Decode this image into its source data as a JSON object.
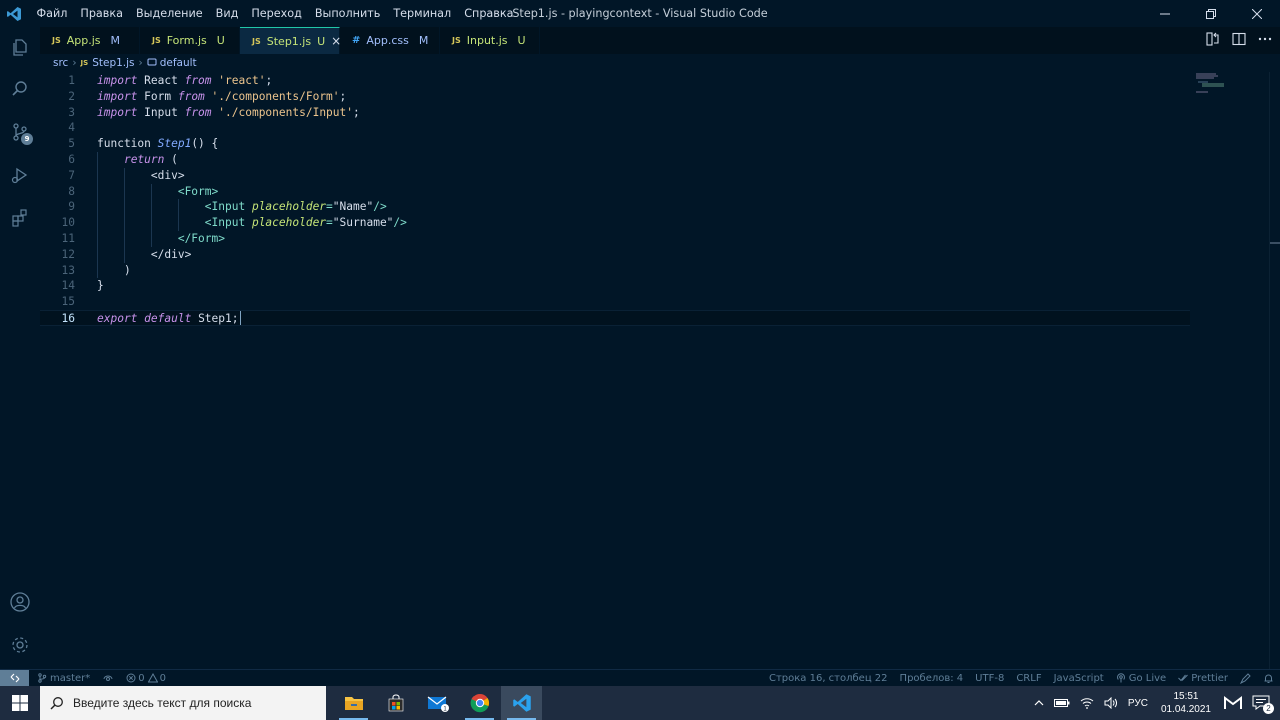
{
  "window": {
    "title": "Step1.js - playingcontext - Visual Studio Code",
    "menu": [
      "Файл",
      "Правка",
      "Выделение",
      "Вид",
      "Переход",
      "Выполнить",
      "Терминал",
      "Справка"
    ]
  },
  "activity_bar": {
    "icons": [
      "files-icon",
      "search-icon",
      "source-control-icon",
      "run-debug-icon",
      "extensions-icon",
      "account-icon",
      "settings-gear-icon"
    ],
    "scm_badge": "9"
  },
  "tabs": [
    {
      "icon": "JS",
      "name": "App.js",
      "status": "M",
      "active": false
    },
    {
      "icon": "JS",
      "name": "Form.js",
      "status": "U",
      "active": false
    },
    {
      "icon": "JS",
      "name": "Step1.js",
      "status": "U",
      "active": true,
      "close": "×"
    },
    {
      "icon": "#",
      "name": "App.css",
      "status": "M",
      "active": false
    },
    {
      "icon": "JS",
      "name": "Input.js",
      "status": "U",
      "active": false
    }
  ],
  "breadcrumb": {
    "folder": "src",
    "file_icon": "JS",
    "file": "Step1.js",
    "symbol": "default"
  },
  "editor": {
    "current_line": 16,
    "lines": [
      {
        "n": "1",
        "tokens": [
          [
            "kw",
            "import"
          ],
          [
            "plain",
            " React "
          ],
          [
            "kw",
            "from"
          ],
          [
            "plain",
            " "
          ],
          [
            "str",
            "'react'"
          ],
          [
            "plain",
            ";"
          ]
        ]
      },
      {
        "n": "2",
        "tokens": [
          [
            "kw",
            "import"
          ],
          [
            "plain",
            " Form "
          ],
          [
            "kw",
            "from"
          ],
          [
            "plain",
            " "
          ],
          [
            "str",
            "'./components/Form'"
          ],
          [
            "plain",
            ";"
          ]
        ]
      },
      {
        "n": "3",
        "tokens": [
          [
            "kw",
            "import"
          ],
          [
            "plain",
            " Input "
          ],
          [
            "kw",
            "from"
          ],
          [
            "plain",
            " "
          ],
          [
            "str",
            "'./components/Input'"
          ],
          [
            "plain",
            ";"
          ]
        ]
      },
      {
        "n": "4",
        "tokens": []
      },
      {
        "n": "5",
        "tokens": [
          [
            "plain",
            "function "
          ],
          [
            "fn",
            "Step1"
          ],
          [
            "plain",
            "() {"
          ]
        ]
      },
      {
        "n": "6",
        "tokens": [
          [
            "plain",
            "    "
          ],
          [
            "kw",
            "return"
          ],
          [
            "plain",
            " ("
          ]
        ]
      },
      {
        "n": "7",
        "tokens": [
          [
            "plain",
            "        "
          ],
          [
            "plain",
            "<div>"
          ]
        ]
      },
      {
        "n": "8",
        "tokens": [
          [
            "plain",
            "            "
          ],
          [
            "tag",
            "<Form>"
          ]
        ]
      },
      {
        "n": "9",
        "tokens": [
          [
            "plain",
            "                "
          ],
          [
            "tag",
            "<Input"
          ],
          [
            "plain",
            " "
          ],
          [
            "attr",
            "placeholder"
          ],
          [
            "tag",
            "="
          ],
          [
            "plain",
            "\"Name\""
          ],
          [
            "tag",
            "/>"
          ]
        ]
      },
      {
        "n": "10",
        "tokens": [
          [
            "plain",
            "                "
          ],
          [
            "tag",
            "<Input"
          ],
          [
            "plain",
            " "
          ],
          [
            "attr",
            "placeholder"
          ],
          [
            "tag",
            "="
          ],
          [
            "plain",
            "\"Surname\""
          ],
          [
            "tag",
            "/>"
          ]
        ]
      },
      {
        "n": "11",
        "tokens": [
          [
            "plain",
            "            "
          ],
          [
            "tag",
            "</Form>"
          ]
        ]
      },
      {
        "n": "12",
        "tokens": [
          [
            "plain",
            "        "
          ],
          [
            "plain",
            "</div>"
          ]
        ]
      },
      {
        "n": "13",
        "tokens": [
          [
            "plain",
            "    )"
          ]
        ]
      },
      {
        "n": "14",
        "tokens": [
          [
            "plain",
            "}"
          ]
        ]
      },
      {
        "n": "15",
        "tokens": []
      },
      {
        "n": "16",
        "tokens": [
          [
            "kw",
            "export"
          ],
          [
            "plain",
            " "
          ],
          [
            "kw",
            "default"
          ],
          [
            "plain",
            " Step1;"
          ]
        ]
      }
    ]
  },
  "status_bar": {
    "branch": "master*",
    "errors": "0",
    "warnings": "0",
    "position": "Строка 16, столбец 22",
    "spaces": "Пробелов: 4",
    "encoding": "UTF-8",
    "eol": "CRLF",
    "language": "JavaScript",
    "go_live": "Go Live",
    "prettier": "Prettier"
  },
  "taskbar": {
    "search_placeholder": "Введите здесь текст для поиска",
    "apps": [
      "file-explorer-icon",
      "store-icon",
      "mail-icon",
      "chrome-icon",
      "vscode-icon"
    ],
    "mail_badge": "1",
    "language": "РУС",
    "time": "15:51",
    "date": "01.04.2021",
    "notifications_badge": "2"
  },
  "colors": {
    "background": "#011627",
    "keyword": "#c792ea",
    "string": "#ecc48d",
    "function": "#82aaff",
    "tag": "#7fdbca",
    "attribute": "#c5e478",
    "taskbar": "#1e2c40"
  }
}
